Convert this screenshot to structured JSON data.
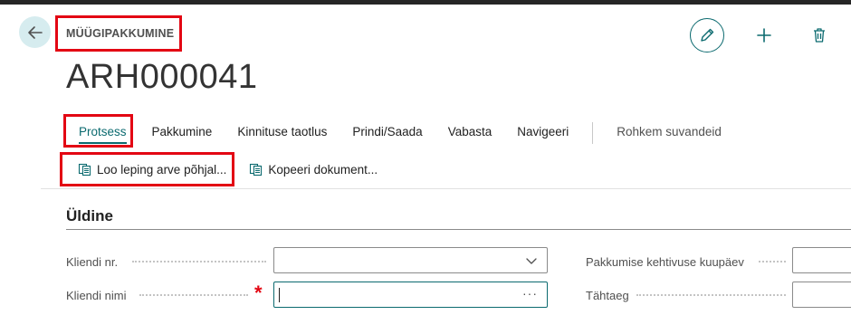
{
  "header": {
    "caption": "MÜÜGIPAKKUMINE",
    "record_title": "ARH000041"
  },
  "icons": {
    "back": "back-arrow-icon",
    "edit": "pencil-icon",
    "add": "plus-icon",
    "delete": "trash-icon",
    "document": "document-copy-icon",
    "dropdown": "chevron-down-icon"
  },
  "menu": {
    "items": [
      {
        "label": "Protsess",
        "active": true
      },
      {
        "label": "Pakkumine"
      },
      {
        "label": "Kinnituse taotlus"
      },
      {
        "label": "Prindi/Saada"
      },
      {
        "label": "Vabasta"
      },
      {
        "label": "Navigeeri"
      }
    ],
    "more_label": "Rohkem suvandeid"
  },
  "subactions": [
    {
      "label": "Loo leping arve põhjal..."
    },
    {
      "label": "Kopeeri dokument..."
    }
  ],
  "section": {
    "title": "Üldine",
    "fields": {
      "customer_no": {
        "label": "Kliendi nr.",
        "value": ""
      },
      "customer_name": {
        "label": "Kliendi nimi",
        "value": "",
        "required": true,
        "required_mark": "*",
        "lookup": "···"
      },
      "quote_valid_until": {
        "label": "Pakkumise kehtivuse kuupäev",
        "value": ""
      },
      "due_date": {
        "label": "Tähtaeg",
        "value": ""
      }
    }
  },
  "colors": {
    "accent": "#0b6a6f",
    "highlight_box": "#e30613",
    "back_button_bg": "#d6ecef"
  }
}
